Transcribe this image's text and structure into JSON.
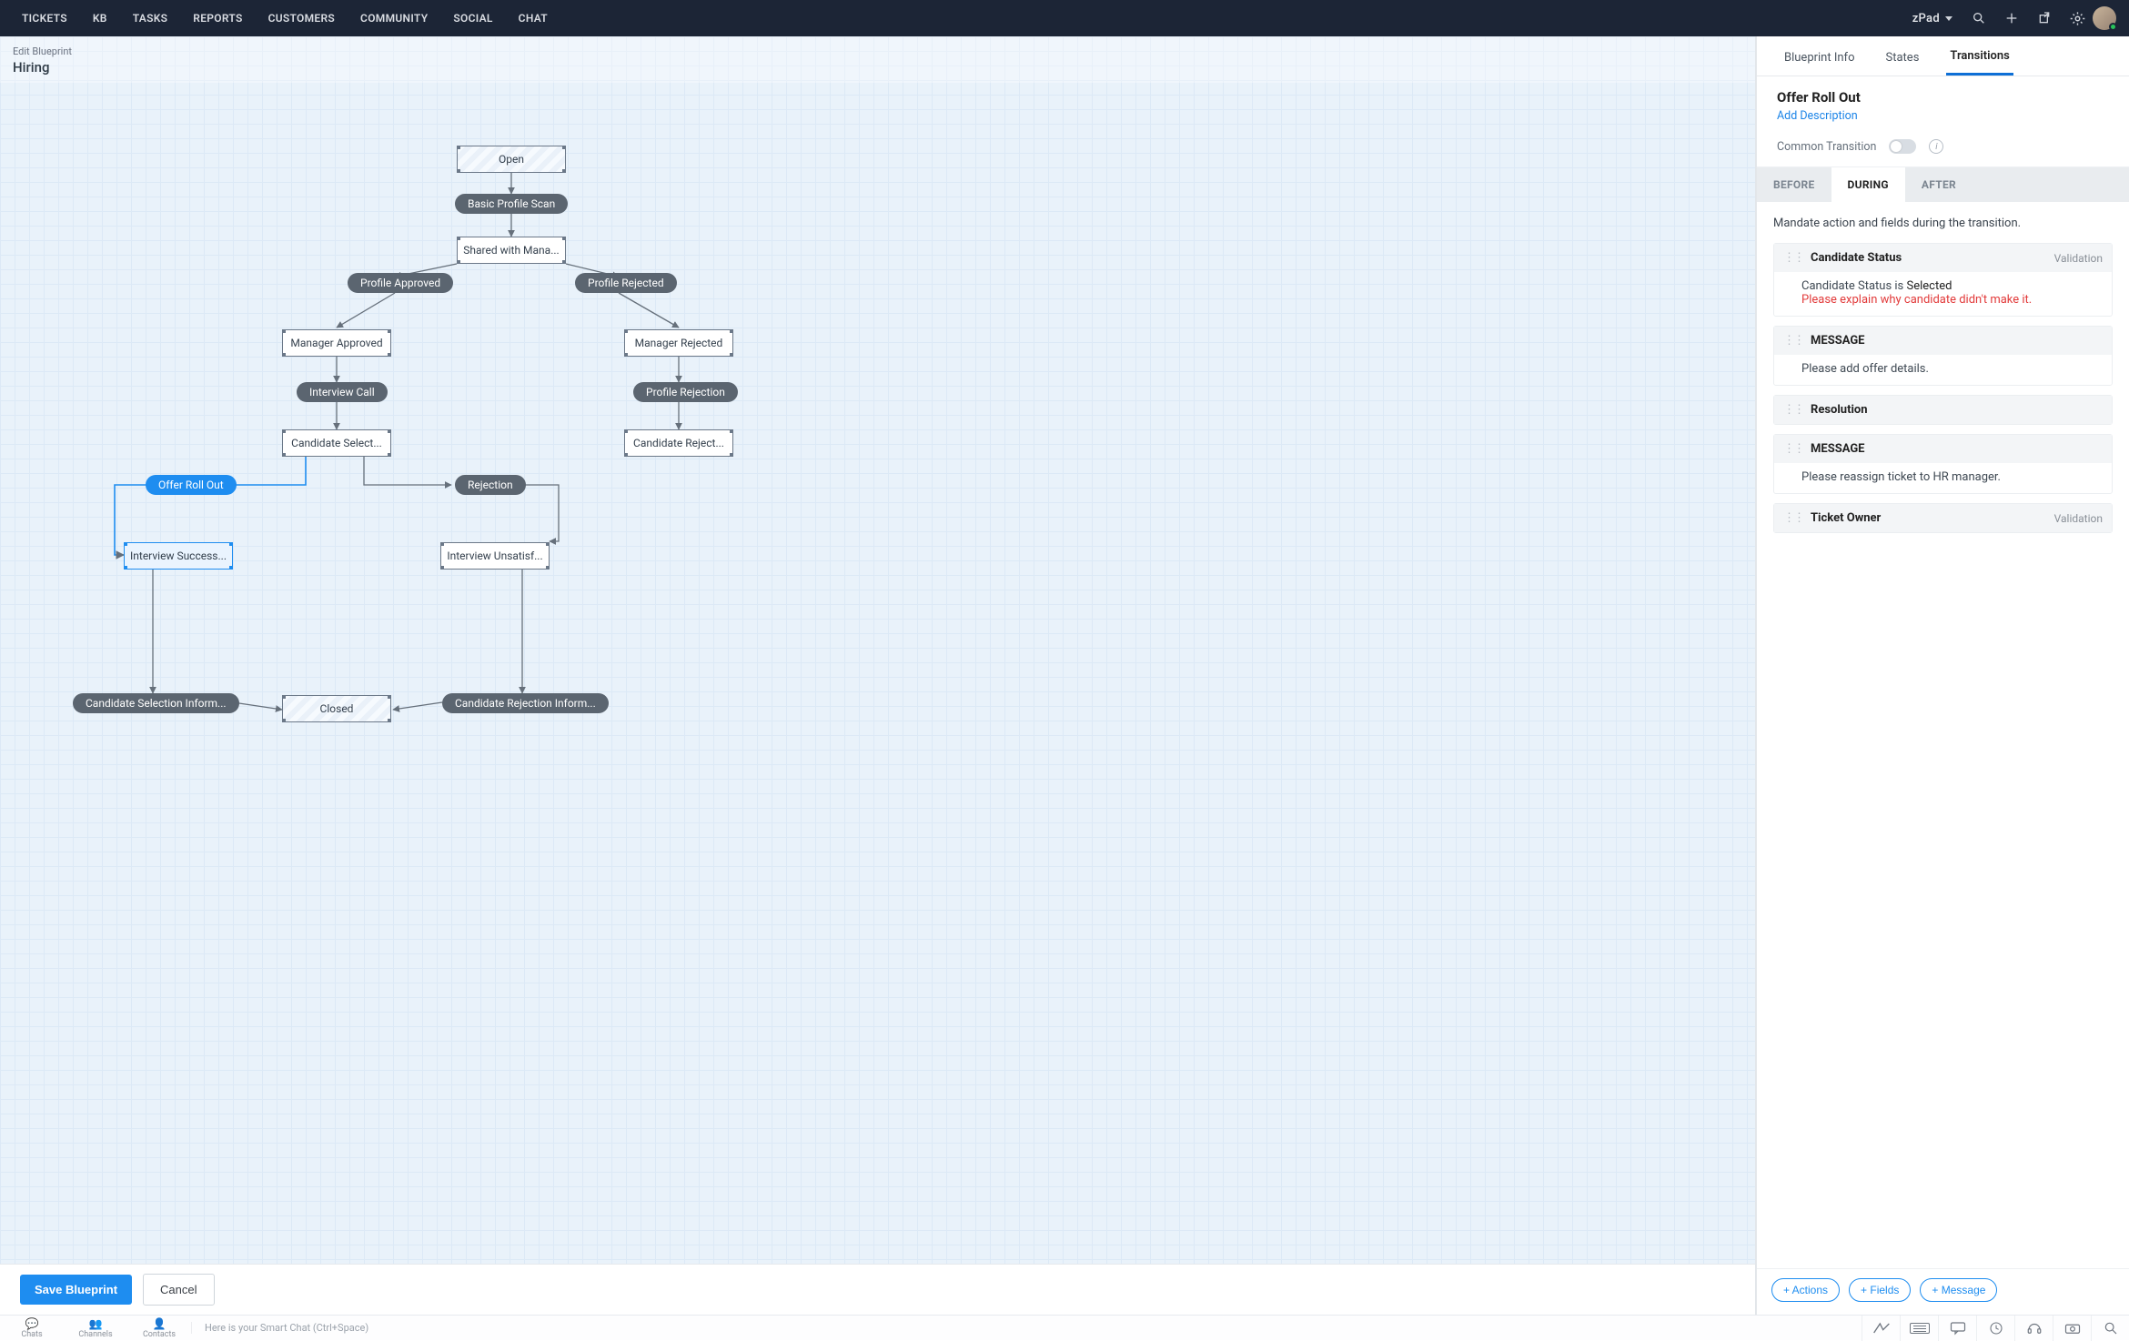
{
  "topnav": {
    "items": [
      "TICKETS",
      "KB",
      "TASKS",
      "REPORTS",
      "CUSTOMERS",
      "COMMUNITY",
      "SOCIAL",
      "CHAT"
    ],
    "brand": "zPad"
  },
  "canvas": {
    "breadcrumb": "Edit Blueprint",
    "title": "Hiring",
    "states": {
      "open": "Open",
      "shared": "Shared with Mana...",
      "mgr_approved": "Manager Approved",
      "mgr_rejected": "Manager Rejected",
      "cand_selected": "Candidate Select...",
      "cand_rejected": "Candidate Reject...",
      "int_success": "Interview Success...",
      "int_unsat": "Interview Unsatisf...",
      "closed": "Closed"
    },
    "transitions": {
      "basic_scan": "Basic Profile Scan",
      "profile_approved": "Profile Approved",
      "profile_rejected": "Profile Rejected",
      "interview_call": "Interview Call",
      "profile_rejection": "Profile Rejection",
      "offer_roll_out": "Offer Roll Out",
      "rejection": "Rejection",
      "cand_sel_inform": "Candidate Selection Inform...",
      "cand_rej_inform": "Candidate Rejection Inform..."
    }
  },
  "props": {
    "tabs": {
      "info": "Blueprint Info",
      "states": "States",
      "transitions": "Transitions"
    },
    "transition_name": "Offer Roll Out",
    "add_description": "Add Description",
    "common_transition_label": "Common Transition",
    "phase_tabs": {
      "before": "BEFORE",
      "during": "DURING",
      "after": "AFTER"
    },
    "hint": "Mandate action and fields during the transition.",
    "items": [
      {
        "name": "Candidate Status",
        "badge": "Validation",
        "body_label": "Candidate Status is",
        "body_value": "Selected",
        "error": "Please explain why candidate didn't make it."
      },
      {
        "name": "MESSAGE",
        "message": "Please add offer details."
      },
      {
        "name": "Resolution"
      },
      {
        "name": "MESSAGE",
        "message": "Please reassign ticket to HR manager."
      },
      {
        "name": "Ticket Owner",
        "badge": "Validation"
      }
    ]
  },
  "footer": {
    "save": "Save Blueprint",
    "cancel": "Cancel",
    "add_actions": "+ Actions",
    "add_fields": "+ Fields",
    "add_message": "+ Message"
  },
  "bottombar": {
    "left": [
      {
        "label": "Chats",
        "icon": "💬"
      },
      {
        "label": "Channels",
        "icon": "👥"
      },
      {
        "label": "Contacts",
        "icon": "👤"
      }
    ],
    "placeholder": "Here is your Smart Chat (Ctrl+Space)"
  }
}
